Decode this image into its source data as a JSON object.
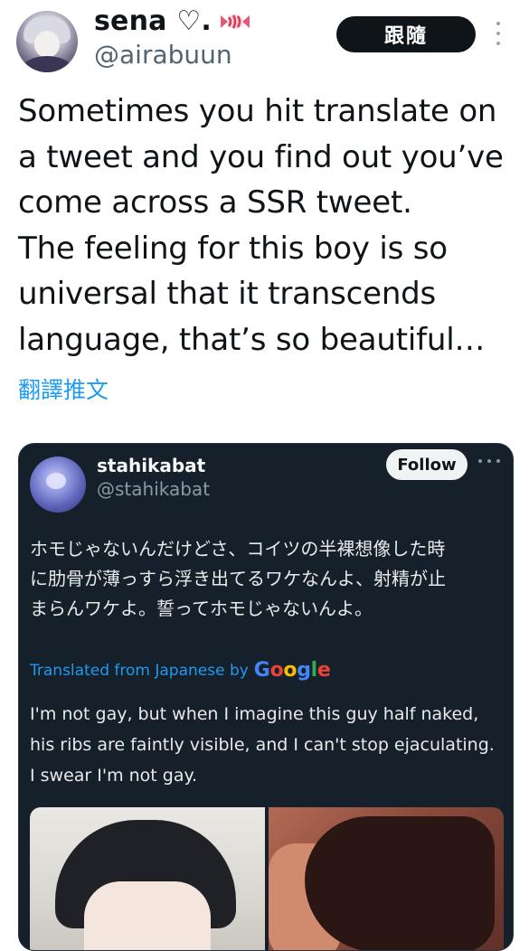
{
  "author": {
    "display_name": "sena ♡.",
    "handle": "@airabuun",
    "follow_label": "跟隨"
  },
  "tweet": {
    "text": "Sometimes you hit translate on\na tweet and you find out you’ve\ncome across a SSR tweet.\nThe feeling for this boy is so\nuniversal that it transcends\nlanguage, that’s so beautiful…",
    "translate_link": "翻譯推文"
  },
  "quoted": {
    "display_name": "stahikabat",
    "handle": "@stahikabat",
    "follow_label": "Follow",
    "original_text": "ホモじゃないんだけどさ、コイツの半裸想像した時\nに肋骨が薄っすら浮き出てるワケなんよ、射精が止\nまらんワケよ。誓ってホモじゃないんよ。",
    "translated_from": "Translated from Japanese by",
    "google": "Google",
    "translated_text": "I'm not gay, but when I imagine this guy half naked,\nhis ribs are faintly visible, and I can't stop ejaculating.\nI swear I'm not gay."
  },
  "icons": {
    "more": "more-vertical-icon",
    "candy": "candy-icon"
  },
  "colors": {
    "link": "#1d9bf0",
    "card_bg": "#15202b"
  }
}
